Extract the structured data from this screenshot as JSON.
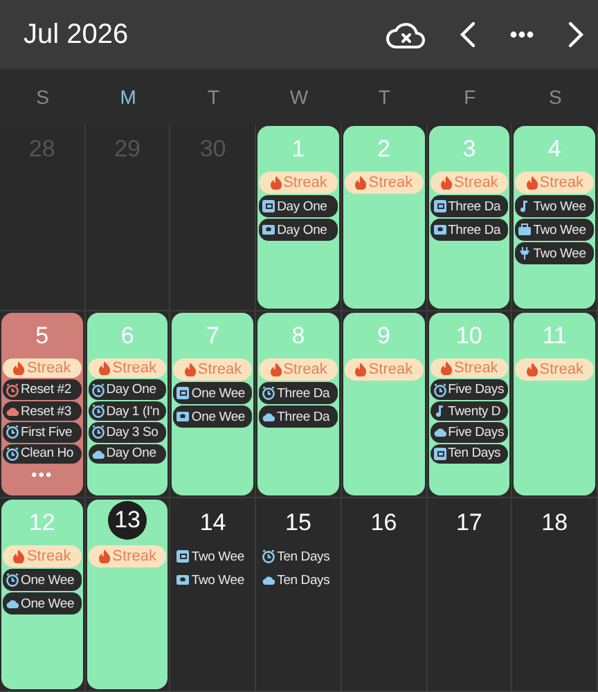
{
  "header": {
    "title": "Jul 2026"
  },
  "weekdays": [
    {
      "label": "S",
      "current": false
    },
    {
      "label": "M",
      "current": true
    },
    {
      "label": "T",
      "current": false
    },
    {
      "label": "W",
      "current": false
    },
    {
      "label": "T",
      "current": false
    },
    {
      "label": "F",
      "current": false
    },
    {
      "label": "S",
      "current": false
    }
  ],
  "weeks": [
    [
      {
        "number": "28",
        "kind": "outside"
      },
      {
        "number": "29",
        "kind": "outside"
      },
      {
        "number": "30",
        "kind": "outside"
      },
      {
        "number": "1",
        "kind": "done",
        "events": [
          {
            "kind": "streak",
            "text": "Streak"
          },
          {
            "kind": "card",
            "text": "Day One",
            "color": "#8ec9f0"
          },
          {
            "kind": "ticket",
            "text": "Day One",
            "color": "#8ec9f0"
          }
        ]
      },
      {
        "number": "2",
        "kind": "done",
        "events": [
          {
            "kind": "streak",
            "text": "Streak"
          }
        ]
      },
      {
        "number": "3",
        "kind": "done",
        "events": [
          {
            "kind": "streak",
            "text": "Streak"
          },
          {
            "kind": "card",
            "text": "Three Da",
            "color": "#8ec9f0"
          },
          {
            "kind": "ticket",
            "text": "Three Da",
            "color": "#8ec9f0"
          }
        ]
      },
      {
        "number": "4",
        "kind": "done",
        "events": [
          {
            "kind": "streak",
            "text": "Streak"
          },
          {
            "kind": "note",
            "text": "Two Wee",
            "color": "#8ec9f0"
          },
          {
            "kind": "case",
            "text": "Two Wee",
            "color": "#8ec9f0"
          },
          {
            "kind": "plug",
            "text": "Two Wee",
            "color": "#8ec9f0"
          }
        ]
      }
    ],
    [
      {
        "number": "5",
        "kind": "missed",
        "more": "•••",
        "events": [
          {
            "kind": "streak",
            "text": "Streak"
          },
          {
            "kind": "clock",
            "text": "Reset #2",
            "color": "#e07a70"
          },
          {
            "kind": "cloud",
            "text": "Reset #3",
            "color": "#e07a70"
          },
          {
            "kind": "clock",
            "text": "First Five",
            "color": "#8ec9f0"
          },
          {
            "kind": "clock",
            "text": "Clean Ho",
            "color": "#8ec9f0"
          }
        ]
      },
      {
        "number": "6",
        "kind": "done",
        "events": [
          {
            "kind": "streak",
            "text": "Streak"
          },
          {
            "kind": "clock",
            "text": "Day One",
            "color": "#8ec9f0"
          },
          {
            "kind": "clock",
            "text": "Day 1 (I'n",
            "color": "#8ec9f0"
          },
          {
            "kind": "clock",
            "text": "Day 3 So",
            "color": "#8ec9f0"
          },
          {
            "kind": "cloud",
            "text": "Day One",
            "color": "#8ec9f0"
          }
        ]
      },
      {
        "number": "7",
        "kind": "done",
        "events": [
          {
            "kind": "streak",
            "text": "Streak"
          },
          {
            "kind": "card",
            "text": "One Wee",
            "color": "#8ec9f0"
          },
          {
            "kind": "ticket",
            "text": "One Wee",
            "color": "#8ec9f0"
          }
        ]
      },
      {
        "number": "8",
        "kind": "done",
        "events": [
          {
            "kind": "streak",
            "text": "Streak"
          },
          {
            "kind": "clock",
            "text": "Three Da",
            "color": "#8ec9f0"
          },
          {
            "kind": "cloud",
            "text": "Three Da",
            "color": "#8ec9f0"
          }
        ]
      },
      {
        "number": "9",
        "kind": "done",
        "events": [
          {
            "kind": "streak",
            "text": "Streak"
          }
        ]
      },
      {
        "number": "10",
        "kind": "done",
        "events": [
          {
            "kind": "streak",
            "text": "Streak"
          },
          {
            "kind": "clock",
            "text": "Five Days",
            "color": "#8ec9f0"
          },
          {
            "kind": "note",
            "text": "Twenty D",
            "color": "#8ec9f0"
          },
          {
            "kind": "cloud",
            "text": "Five Days",
            "color": "#8ec9f0"
          },
          {
            "kind": "card",
            "text": "Ten Days",
            "color": "#8ec9f0"
          }
        ]
      },
      {
        "number": "11",
        "kind": "done",
        "events": [
          {
            "kind": "streak",
            "text": "Streak"
          }
        ]
      }
    ],
    [
      {
        "number": "12",
        "kind": "done",
        "events": [
          {
            "kind": "streak",
            "text": "Streak"
          },
          {
            "kind": "clock",
            "text": "One Wee",
            "color": "#8ec9f0"
          },
          {
            "kind": "cloud",
            "text": "One Wee",
            "color": "#8ec9f0"
          }
        ]
      },
      {
        "number": "13",
        "kind": "today",
        "events": [
          {
            "kind": "streak",
            "text": "Streak"
          }
        ]
      },
      {
        "number": "14",
        "kind": "future",
        "events": [
          {
            "kind": "card",
            "text": "Two Wee",
            "color": "#8ec9f0"
          },
          {
            "kind": "ticket",
            "text": "Two Wee",
            "color": "#8ec9f0"
          }
        ]
      },
      {
        "number": "15",
        "kind": "future",
        "events": [
          {
            "kind": "clock",
            "text": "Ten Days",
            "color": "#8ec9f0"
          },
          {
            "kind": "cloud",
            "text": "Ten Days",
            "color": "#8ec9f0"
          }
        ]
      },
      {
        "number": "16",
        "kind": "future"
      },
      {
        "number": "17",
        "kind": "future"
      },
      {
        "number": "18",
        "kind": "future"
      }
    ]
  ]
}
